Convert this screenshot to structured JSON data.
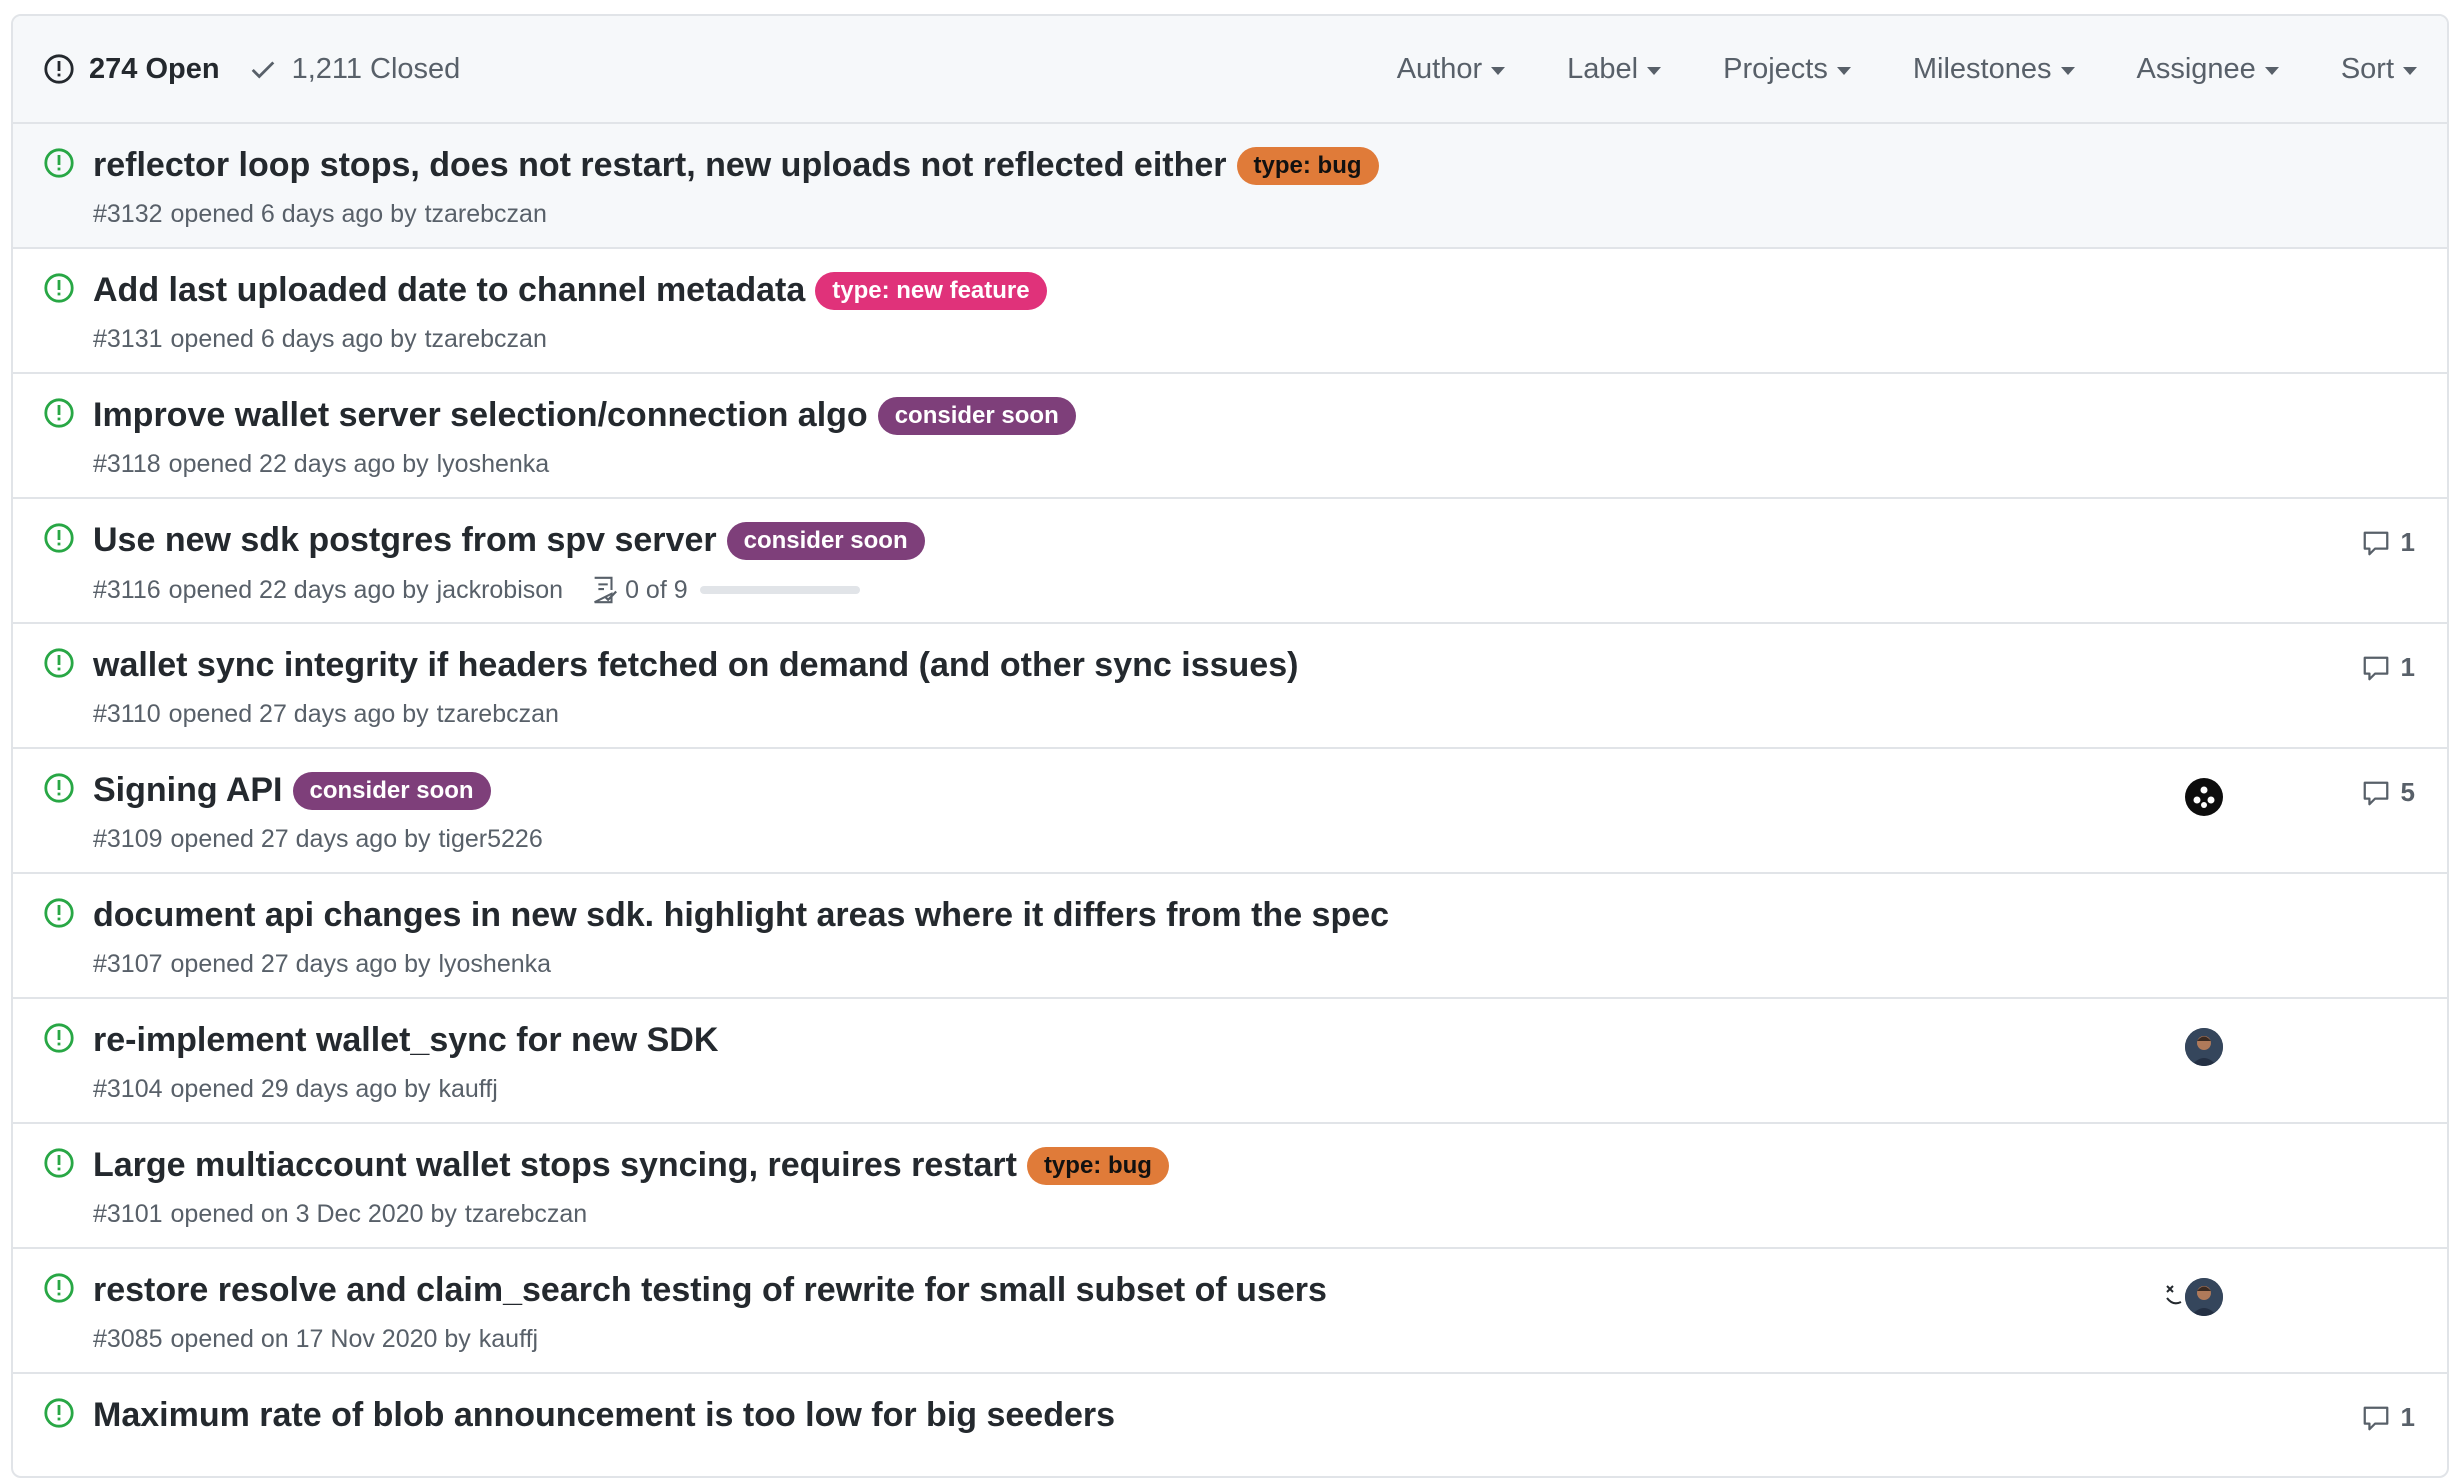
{
  "header": {
    "open_count": "274 Open",
    "closed_count": "1,211 Closed",
    "filters": [
      "Author",
      "Label",
      "Projects",
      "Milestones",
      "Assignee",
      "Sort"
    ]
  },
  "colors": {
    "open_icon": "#28a745",
    "label_bug": "#e07b39",
    "label_feature": "#e0327a",
    "label_consider": "#7e3f7a"
  },
  "issues": [
    {
      "title": "reflector loop stops, does not restart, new uploads not reflected either",
      "label": "type: bug",
      "number": "#3132",
      "opened": "opened 6 days ago by",
      "author": "tzarebczan"
    },
    {
      "title": "Add last uploaded date to channel metadata",
      "label": "type: new feature",
      "number": "#3131",
      "opened": "opened 6 days ago by",
      "author": "tzarebczan"
    },
    {
      "title": "Improve wallet server selection/connection algo",
      "label": "consider soon",
      "number": "#3118",
      "opened": "opened 22 days ago by",
      "author": "lyoshenka"
    },
    {
      "title": "Use new sdk postgres from spv server",
      "label": "consider soon",
      "number": "#3116",
      "opened": "opened 22 days ago by",
      "author": "jackrobison",
      "tasks": "0 of 9",
      "task_progress": 0,
      "comments": "1"
    },
    {
      "title": "wallet sync integrity if headers fetched on demand (and other sync issues)",
      "number": "#3110",
      "opened": "opened 27 days ago by",
      "author": "tzarebczan",
      "comments": "1"
    },
    {
      "title": "Signing API",
      "label": "consider soon",
      "number": "#3109",
      "opened": "opened 27 days ago by",
      "author": "tiger5226",
      "comments": "5"
    },
    {
      "title": "document api changes in new sdk. highlight areas where it differs from the spec",
      "number": "#3107",
      "opened": "opened 27 days ago by",
      "author": "lyoshenka"
    },
    {
      "title": "re-implement wallet_sync for new SDK",
      "number": "#3104",
      "opened": "opened 29 days ago by",
      "author": "kauffj"
    },
    {
      "title": "Large multiaccount wallet stops syncing, requires restart",
      "label": "type: bug",
      "number": "#3101",
      "opened": "opened on 3 Dec 2020 by",
      "author": "tzarebczan"
    },
    {
      "title": "restore resolve and claim_search testing of rewrite for small subset of users",
      "number": "#3085",
      "opened": "opened on 17 Nov 2020 by",
      "author": "kauffj"
    },
    {
      "title": "Maximum rate of blob announcement is too low for big seeders",
      "comments": "1"
    }
  ]
}
